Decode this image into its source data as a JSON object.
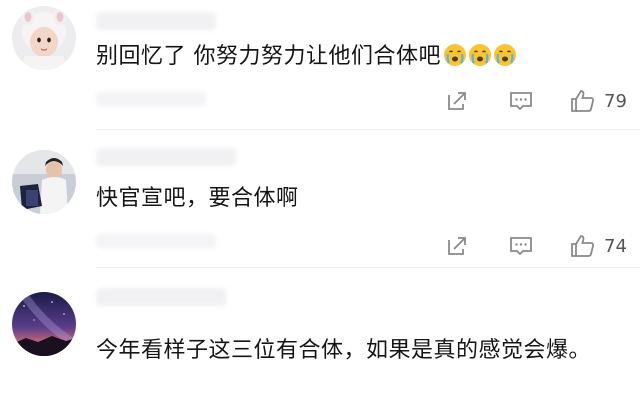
{
  "comments": [
    {
      "text": "别回忆了 你努力努力让他们合体吧",
      "emojis": [
        "crying-face-emoji",
        "crying-face-emoji",
        "crying-face-emoji"
      ],
      "likes": "79"
    },
    {
      "text": "快官宣吧，要合体啊",
      "emojis": [],
      "likes": "74"
    },
    {
      "text": "今年看样子这三位有合体，如果是真的感觉会爆。",
      "emojis": [],
      "likes": ""
    }
  ],
  "icons": {
    "share": "share-icon",
    "reply": "reply-icon",
    "like": "thumbs-up-icon"
  },
  "colors": {
    "text": "#151515",
    "icon": "#8a8a8a",
    "divider": "#ececec",
    "emoji": "#f7c531"
  }
}
